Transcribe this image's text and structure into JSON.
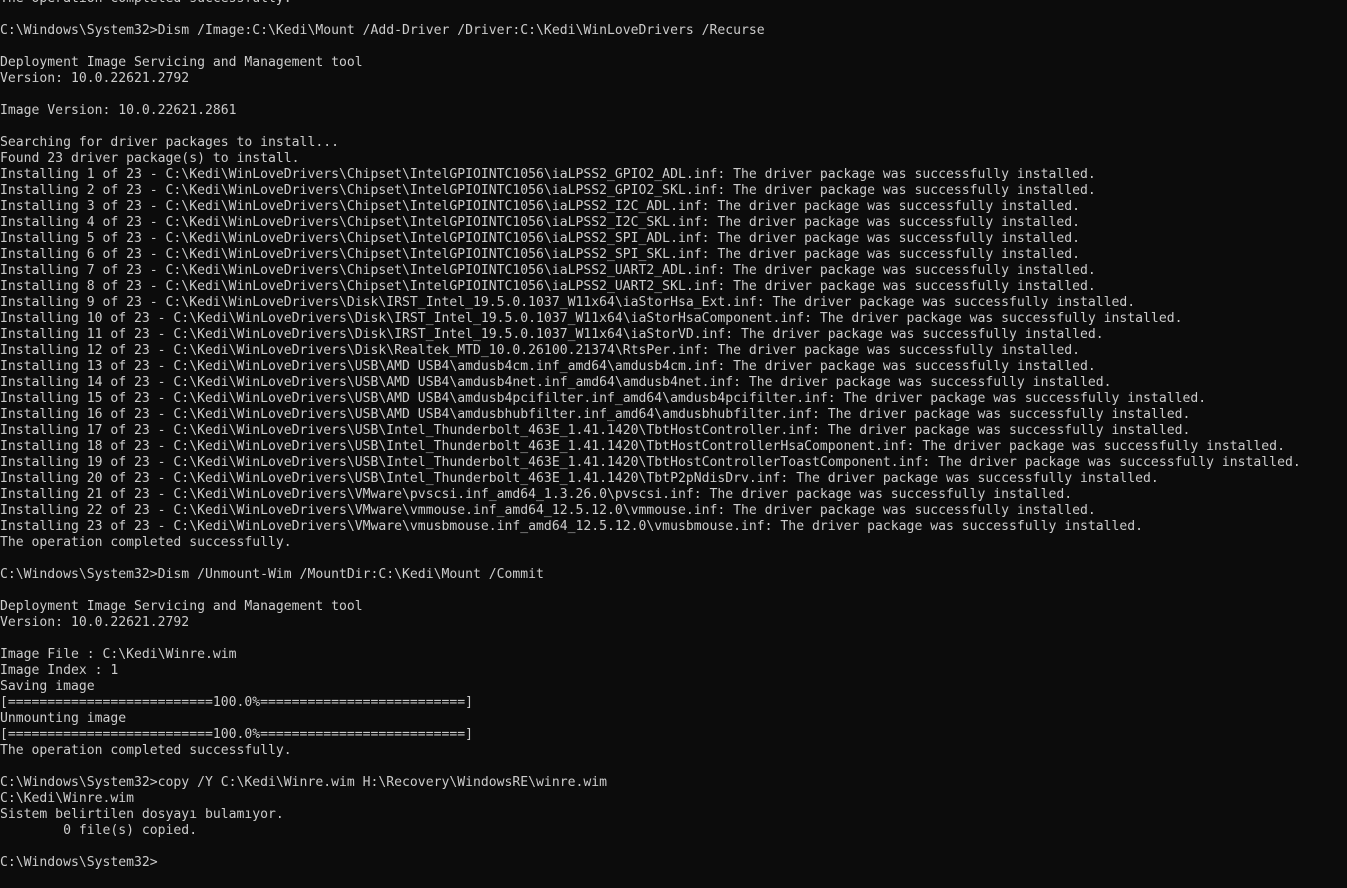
{
  "terminal": {
    "lines": [
      "The operation completed successfully.",
      "",
      "C:\\Windows\\System32>Dism /Image:C:\\Kedi\\Mount /Add-Driver /Driver:C:\\Kedi\\WinLoveDrivers /Recurse",
      "",
      "Deployment Image Servicing and Management tool",
      "Version: 10.0.22621.2792",
      "",
      "Image Version: 10.0.22621.2861",
      "",
      "Searching for driver packages to install...",
      "Found 23 driver package(s) to install.",
      "Installing 1 of 23 - C:\\Kedi\\WinLoveDrivers\\Chipset\\IntelGPIOINTC1056\\iaLPSS2_GPIO2_ADL.inf: The driver package was successfully installed.",
      "Installing 2 of 23 - C:\\Kedi\\WinLoveDrivers\\Chipset\\IntelGPIOINTC1056\\iaLPSS2_GPIO2_SKL.inf: The driver package was successfully installed.",
      "Installing 3 of 23 - C:\\Kedi\\WinLoveDrivers\\Chipset\\IntelGPIOINTC1056\\iaLPSS2_I2C_ADL.inf: The driver package was successfully installed.",
      "Installing 4 of 23 - C:\\Kedi\\WinLoveDrivers\\Chipset\\IntelGPIOINTC1056\\iaLPSS2_I2C_SKL.inf: The driver package was successfully installed.",
      "Installing 5 of 23 - C:\\Kedi\\WinLoveDrivers\\Chipset\\IntelGPIOINTC1056\\iaLPSS2_SPI_ADL.inf: The driver package was successfully installed.",
      "Installing 6 of 23 - C:\\Kedi\\WinLoveDrivers\\Chipset\\IntelGPIOINTC1056\\iaLPSS2_SPI_SKL.inf: The driver package was successfully installed.",
      "Installing 7 of 23 - C:\\Kedi\\WinLoveDrivers\\Chipset\\IntelGPIOINTC1056\\iaLPSS2_UART2_ADL.inf: The driver package was successfully installed.",
      "Installing 8 of 23 - C:\\Kedi\\WinLoveDrivers\\Chipset\\IntelGPIOINTC1056\\iaLPSS2_UART2_SKL.inf: The driver package was successfully installed.",
      "Installing 9 of 23 - C:\\Kedi\\WinLoveDrivers\\Disk\\IRST_Intel_19.5.0.1037_W11x64\\iaStorHsa_Ext.inf: The driver package was successfully installed.",
      "Installing 10 of 23 - C:\\Kedi\\WinLoveDrivers\\Disk\\IRST_Intel_19.5.0.1037_W11x64\\iaStorHsaComponent.inf: The driver package was successfully installed.",
      "Installing 11 of 23 - C:\\Kedi\\WinLoveDrivers\\Disk\\IRST_Intel_19.5.0.1037_W11x64\\iaStorVD.inf: The driver package was successfully installed.",
      "Installing 12 of 23 - C:\\Kedi\\WinLoveDrivers\\Disk\\Realtek_MTD_10.0.26100.21374\\RtsPer.inf: The driver package was successfully installed.",
      "Installing 13 of 23 - C:\\Kedi\\WinLoveDrivers\\USB\\AMD USB4\\amdusb4cm.inf_amd64\\amdusb4cm.inf: The driver package was successfully installed.",
      "Installing 14 of 23 - C:\\Kedi\\WinLoveDrivers\\USB\\AMD USB4\\amdusb4net.inf_amd64\\amdusb4net.inf: The driver package was successfully installed.",
      "Installing 15 of 23 - C:\\Kedi\\WinLoveDrivers\\USB\\AMD USB4\\amdusb4pcifilter.inf_amd64\\amdusb4pcifilter.inf: The driver package was successfully installed.",
      "Installing 16 of 23 - C:\\Kedi\\WinLoveDrivers\\USB\\AMD USB4\\amdusbhubfilter.inf_amd64\\amdusbhubfilter.inf: The driver package was successfully installed.",
      "Installing 17 of 23 - C:\\Kedi\\WinLoveDrivers\\USB\\Intel_Thunderbolt_463E_1.41.1420\\TbtHostController.inf: The driver package was successfully installed.",
      "Installing 18 of 23 - C:\\Kedi\\WinLoveDrivers\\USB\\Intel_Thunderbolt_463E_1.41.1420\\TbtHostControllerHsaComponent.inf: The driver package was successfully installed.",
      "Installing 19 of 23 - C:\\Kedi\\WinLoveDrivers\\USB\\Intel_Thunderbolt_463E_1.41.1420\\TbtHostControllerToastComponent.inf: The driver package was successfully installed.",
      "Installing 20 of 23 - C:\\Kedi\\WinLoveDrivers\\USB\\Intel_Thunderbolt_463E_1.41.1420\\TbtP2pNdisDrv.inf: The driver package was successfully installed.",
      "Installing 21 of 23 - C:\\Kedi\\WinLoveDrivers\\VMware\\pvscsi.inf_amd64_1.3.26.0\\pvscsi.inf: The driver package was successfully installed.",
      "Installing 22 of 23 - C:\\Kedi\\WinLoveDrivers\\VMware\\vmmouse.inf_amd64_12.5.12.0\\vmmouse.inf: The driver package was successfully installed.",
      "Installing 23 of 23 - C:\\Kedi\\WinLoveDrivers\\VMware\\vmusbmouse.inf_amd64_12.5.12.0\\vmusbmouse.inf: The driver package was successfully installed.",
      "The operation completed successfully.",
      "",
      "C:\\Windows\\System32>Dism /Unmount-Wim /MountDir:C:\\Kedi\\Mount /Commit",
      "",
      "Deployment Image Servicing and Management tool",
      "Version: 10.0.22621.2792",
      "",
      "Image File : C:\\Kedi\\Winre.wim",
      "Image Index : 1",
      "Saving image",
      "[==========================100.0%==========================]",
      "Unmounting image",
      "[==========================100.0%==========================]",
      "The operation completed successfully.",
      "",
      "C:\\Windows\\System32>copy /Y C:\\Kedi\\Winre.wim H:\\Recovery\\WindowsRE\\winre.wim",
      "C:\\Kedi\\Winre.wim",
      "Sistem belirtilen dosyayı bulamıyor.",
      "        0 file(s) copied.",
      "",
      "C:\\Windows\\System32>"
    ],
    "colors": {
      "background": "#0c0c0c",
      "foreground": "#cccccc"
    }
  }
}
